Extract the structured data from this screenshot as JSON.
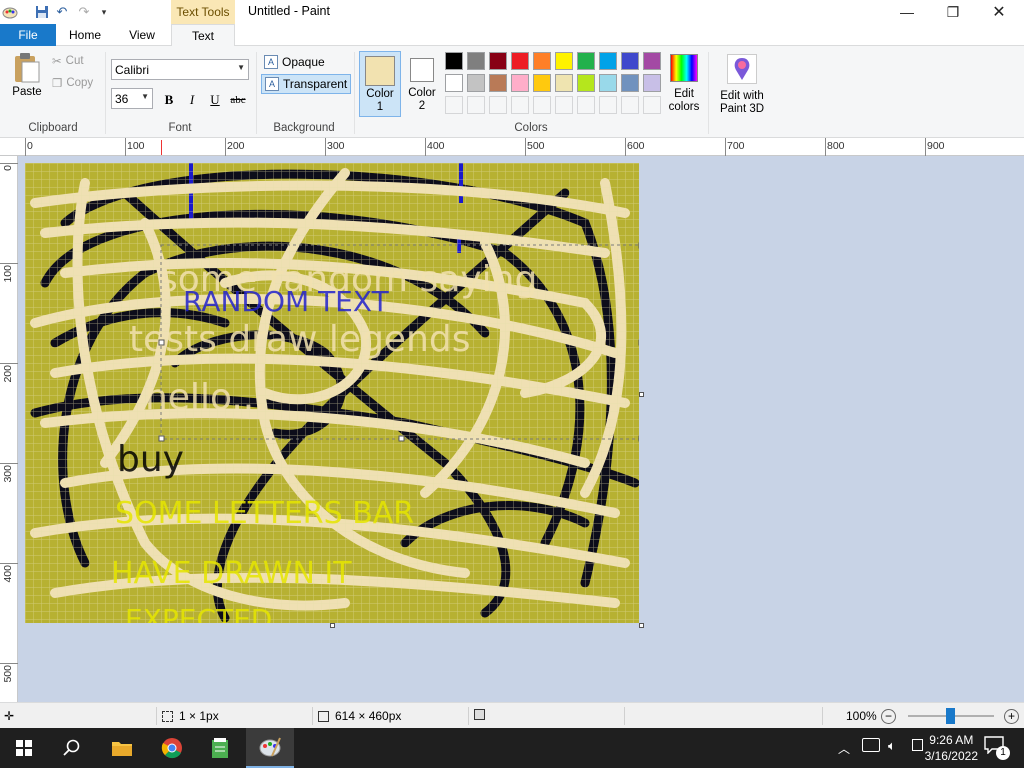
{
  "title_bar": {
    "context_tab": "Text Tools",
    "window_title": "Untitled - Paint",
    "quick_access": [
      "save-icon",
      "undo-icon",
      "redo-icon",
      "customize-icon"
    ]
  },
  "tabs": {
    "file": "File",
    "home": "Home",
    "view": "View",
    "text": "Text"
  },
  "clipboard": {
    "paste": "Paste",
    "cut": "Cut",
    "copy": "Copy",
    "label": "Clipboard"
  },
  "font": {
    "family": "Calibri",
    "size": "36",
    "bold": "B",
    "italic": "I",
    "underline": "U",
    "strike": "abc",
    "label": "Font"
  },
  "background": {
    "opaque": "Opaque",
    "transparent": "Transparent",
    "label": "Background"
  },
  "colors": {
    "color1_label": "Color\n1",
    "color1_label_a": "Color",
    "color1_label_b": "1",
    "color2_label_a": "Color",
    "color2_label_b": "2",
    "color1": "#f2e2b0",
    "color2": "#ffffff",
    "edit_colors_a": "Edit",
    "edit_colors_b": "colors",
    "label": "Colors",
    "palette_row1": [
      "#000000",
      "#7f7f7f",
      "#880015",
      "#ed1c24",
      "#ff7f27",
      "#fff200",
      "#22b14c",
      "#00a2e8",
      "#3f48cc",
      "#a349a4"
    ],
    "palette_row2": [
      "#ffffff",
      "#c3c3c3",
      "#b97a57",
      "#ffaec9",
      "#ffc90e",
      "#efe4b0",
      "#b5e61d",
      "#99d9ea",
      "#7092be",
      "#c8bfe7"
    ]
  },
  "paint3d": {
    "line1": "Edit with",
    "line2": "Paint 3D"
  },
  "ruler": {
    "h_labels": [
      "0",
      "100",
      "200",
      "300",
      "400",
      "500",
      "600",
      "700",
      "800",
      "900"
    ],
    "v_labels": [
      "0",
      "100",
      "200",
      "300",
      "400",
      "500"
    ]
  },
  "canvas": {
    "bg_color": "#b7b132",
    "text_lines": [
      {
        "text": "some random saying",
        "color": "#f2e2b0"
      },
      {
        "text": "RANDOM TEXT",
        "color": "#2222cc"
      },
      {
        "text": "tests draw legends",
        "color": "#f2e2b0"
      },
      {
        "text": "hello...",
        "color": "#f2e2b0"
      },
      {
        "text": "buy",
        "color": "#000000"
      },
      {
        "text": "SOME LETTERS BAR",
        "color": "#e6e600"
      },
      {
        "text": "HAVE DRAWN IT",
        "color": "#e6e600"
      },
      {
        "text": "EXPECTED",
        "color": "#e6e600"
      }
    ]
  },
  "status": {
    "cursor_pos": "",
    "selection_size": "1 × 1px",
    "image_size": "614 × 460px",
    "zoom": "100%"
  },
  "taskbar": {
    "time": "9:26 AM",
    "date": "3/16/2022",
    "notification_count": "1"
  }
}
